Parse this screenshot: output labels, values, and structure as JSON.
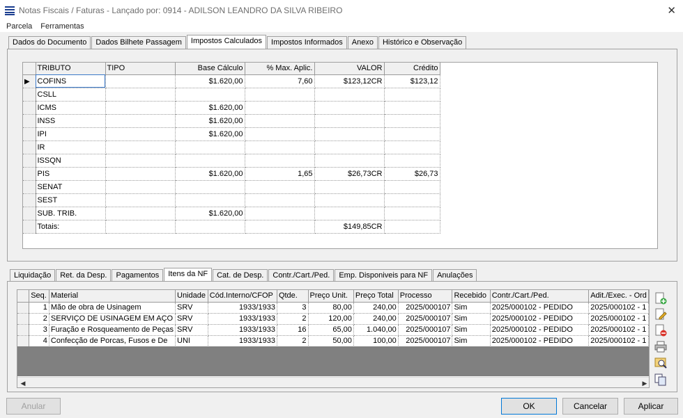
{
  "window": {
    "title": "Notas Fiscais / Faturas - Lançado por: 0914 - ADILSON LEANDRO DA SILVA RIBEIRO"
  },
  "menu": [
    "Parcela",
    "Ferramentas"
  ],
  "top_tabs": [
    "Dados do Documento",
    "Dados Bilhete Passagem",
    "Impostos Calculados",
    "Impostos Informados",
    "Anexo",
    "Histórico e Observação"
  ],
  "top_tab_active": 2,
  "taxes": {
    "columns": [
      "TRIBUTO",
      "TIPO",
      "Base Cálculo",
      "% Max. Aplic.",
      "VALOR",
      "Crédito"
    ],
    "rows": [
      [
        "COFINS",
        "",
        "$1.620,00",
        "7,60",
        "$123,12CR",
        "$123,12"
      ],
      [
        "CSLL",
        "",
        "",
        "",
        "",
        ""
      ],
      [
        "ICMS",
        "",
        "$1.620,00",
        "",
        "",
        ""
      ],
      [
        "INSS",
        "",
        "$1.620,00",
        "",
        "",
        ""
      ],
      [
        "IPI",
        "",
        "$1.620,00",
        "",
        "",
        ""
      ],
      [
        "IR",
        "",
        "",
        "",
        "",
        ""
      ],
      [
        "ISSQN",
        "",
        "",
        "",
        "",
        ""
      ],
      [
        "PIS",
        "",
        "$1.620,00",
        "1,65",
        "$26,73CR",
        "$26,73"
      ],
      [
        "SENAT",
        "",
        "",
        "",
        "",
        ""
      ],
      [
        "SEST",
        "",
        "",
        "",
        "",
        ""
      ],
      [
        "SUB. TRIB.",
        "",
        "$1.620,00",
        "",
        "",
        ""
      ],
      [
        "Totais:",
        "",
        "",
        "",
        "$149,85CR",
        ""
      ]
    ]
  },
  "bottom_tabs": [
    "Liquidação",
    "Ret. da Desp.",
    "Pagamentos",
    "Itens da NF",
    "Cat. de Desp.",
    "Contr./Cart./Ped.",
    "Emp. Disponiveis para NF",
    "Anulações"
  ],
  "bottom_tab_active": 3,
  "items": {
    "columns": [
      "Seq.",
      "Material",
      "Unidade",
      "Cód.Interno/CFOP",
      "Qtde.",
      "Preço Unit.",
      "Preço Total",
      "Processo",
      "Recebido",
      "Contr./Cart./Ped.",
      "Adit./Exec. - Ord"
    ],
    "rows": [
      [
        "1",
        "Mão de obra de Usinagem",
        "SRV",
        "1933/1933",
        "3",
        "80,00",
        "240,00",
        "2025/000107",
        "Sim",
        "2025/000102 - PEDIDO",
        "2025/000102 - 1"
      ],
      [
        "2",
        "SERVIÇO DE USINAGEM EM AÇO",
        "SRV",
        "1933/1933",
        "2",
        "120,00",
        "240,00",
        "2025/000107",
        "Sim",
        "2025/000102 - PEDIDO",
        "2025/000102 - 1"
      ],
      [
        "3",
        "Furação e Rosqueamento de Peças",
        "SRV",
        "1933/1933",
        "16",
        "65,00",
        "1.040,00",
        "2025/000107",
        "Sim",
        "2025/000102 - PEDIDO",
        "2025/000102 - 1"
      ],
      [
        "4",
        "Confecção de Porcas, Fusos e De",
        "UNI",
        "1933/1933",
        "2",
        "50,00",
        "100,00",
        "2025/000107",
        "Sim",
        "2025/000102 - PEDIDO",
        "2025/000102 - 1"
      ]
    ]
  },
  "side_tools": [
    "add-doc-icon",
    "edit-doc-icon",
    "delete-doc-icon",
    "print-icon",
    "search-doc-icon",
    "copy-icon"
  ],
  "buttons": {
    "anular": "Anular",
    "ok": "OK",
    "cancelar": "Cancelar",
    "aplicar": "Aplicar"
  }
}
